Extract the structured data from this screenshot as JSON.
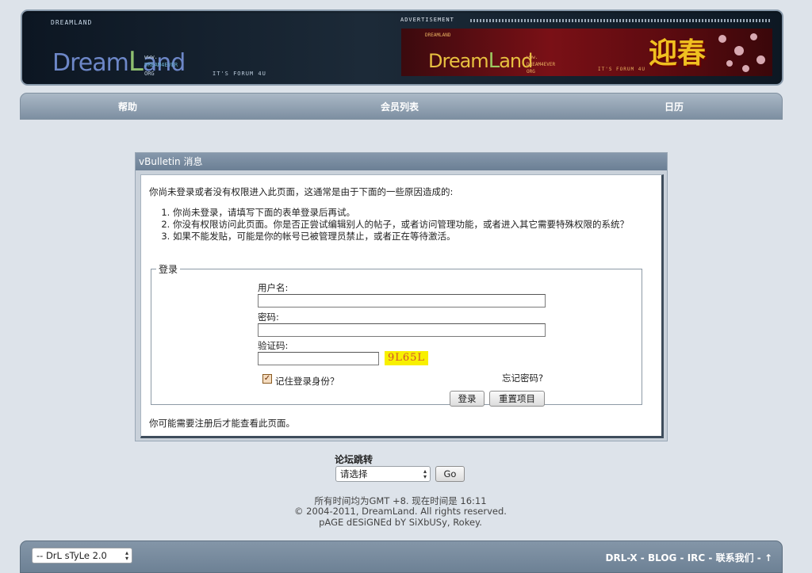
{
  "header": {
    "logo_small": "DREAMLAND",
    "logo_name_d": "D",
    "logo_name_ream": "ream",
    "logo_name_l": "L",
    "logo_name_and": "and",
    "logo_www": "www.",
    "logo_dream4ever": "DREAM4EVER",
    "logo_org": "ORG",
    "logo_tagline": "IT'S FORUM 4U",
    "ad_label": "ADVERTISEMENT",
    "ad_chun": "迎春"
  },
  "nav": {
    "items": [
      {
        "label": "帮助"
      },
      {
        "label": "会员列表"
      },
      {
        "label": "日历"
      }
    ]
  },
  "panel": {
    "title": "vBulletin 消息",
    "intro": "你尚未登录或者没有权限进入此页面，这通常是由于下面的一些原因造成的:",
    "reasons": [
      "你尚未登录，请填写下面的表单登录后再试。",
      "你没有权限访问此页面。你是否正尝试编辑别人的帖子，或者访问管理功能，或者进入其它需要特殊权限的系统？",
      "如果不能发贴，可能是你的帐号已被管理员禁止，或者正在等待激活。"
    ],
    "login_legend": "登录",
    "username_label": "用户名:",
    "password_label": "密码:",
    "captcha_label": "验证码:",
    "captcha_text": "9L65L",
    "forgot_password": "忘记密码?",
    "remember_me": "记住登录身份？",
    "login_button": "登录",
    "reset_button": "重置项目",
    "need_register_prefix": "你可能需要",
    "need_register_link": "注册",
    "need_register_suffix": "后才能查看此页面。"
  },
  "jump": {
    "label": "论坛跳转",
    "select_value": "请选择",
    "go_button": "Go"
  },
  "footer": {
    "time_line": "所有时间均为GMT +8. 现在时间是 16:11",
    "copyright": "© 2004-2011, DreamLand. All rights reserved.",
    "designed": "pAGE dESiGNEd bY SiXbUSy, Rokey.",
    "style_select": "-- DrL sTyLe 2.0",
    "links": [
      {
        "label": "DRL-X"
      },
      {
        "label": "BLOG"
      },
      {
        "label": "IRC"
      },
      {
        "label": "联系我们"
      },
      {
        "label": "↑"
      }
    ],
    "link_separator": " - "
  },
  "colors": {
    "page_bg": "#dde3ea",
    "nav_bg": "#8a9bad",
    "panel_title_bg": "#7a8ca0",
    "captcha_bg": "#f8f000"
  }
}
